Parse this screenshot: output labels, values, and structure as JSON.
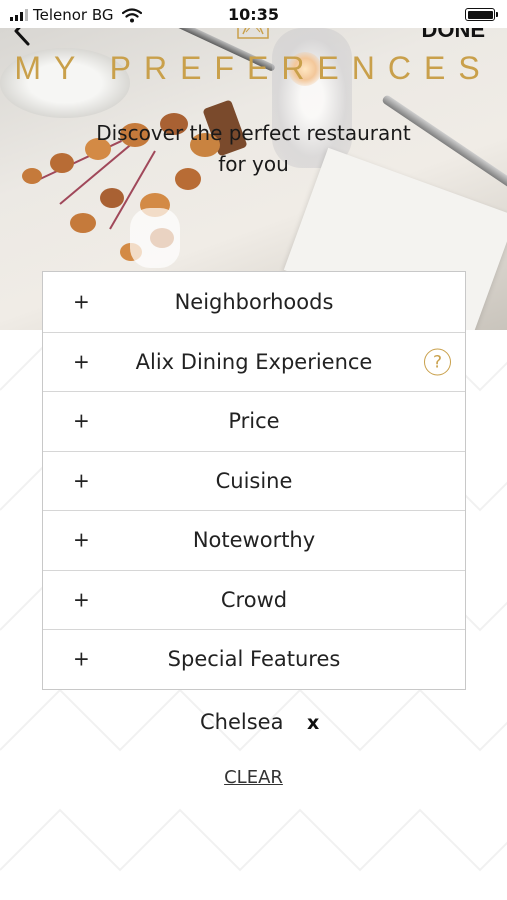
{
  "status_bar": {
    "carrier": "Telenor BG",
    "time": "10:35",
    "signal_icon": "signal-icon",
    "wifi_icon": "wifi-icon",
    "battery_icon": "battery-icon"
  },
  "header": {
    "back_icon": "chevron-left-icon",
    "logo": "alix-logo",
    "done_label": "DONE",
    "title": "MY PREFERENCES",
    "subtitle_line1": "Discover the perfect restaurant",
    "subtitle_line2": "for you"
  },
  "preferences": {
    "items": [
      {
        "icon": "+",
        "label": "Neighborhoods"
      },
      {
        "icon": "+",
        "label": "Alix Dining Experience",
        "help": "?"
      },
      {
        "icon": "+",
        "label": "Price"
      },
      {
        "icon": "+",
        "label": "Cuisine"
      },
      {
        "icon": "+",
        "label": "Noteworthy"
      },
      {
        "icon": "+",
        "label": "Crowd"
      },
      {
        "icon": "+",
        "label": "Special Features"
      }
    ]
  },
  "selected": {
    "chip_label": "Chelsea",
    "remove_label": "x"
  },
  "clear_label": "CLEAR",
  "colors": {
    "accent_gold": "#c9a04b",
    "text": "#222222",
    "border": "#c8c8c8"
  }
}
